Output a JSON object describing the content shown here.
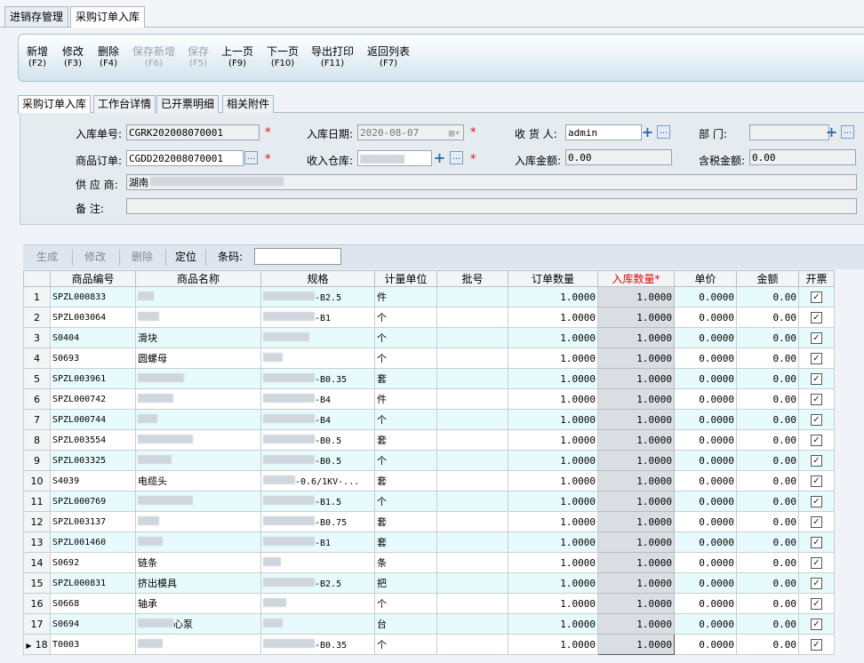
{
  "top_tabs": [
    "进销存管理",
    "采购订单入库"
  ],
  "toolbar": [
    {
      "label": "新增",
      "key": "(F2)",
      "enabled": true
    },
    {
      "label": "修改",
      "key": "(F3)",
      "enabled": true
    },
    {
      "label": "删除",
      "key": "(F4)",
      "enabled": true
    },
    {
      "label": "保存新增",
      "key": "(F6)",
      "enabled": false
    },
    {
      "label": "保存",
      "key": "(F5)",
      "enabled": false
    },
    {
      "label": "上一页",
      "key": "(F9)",
      "enabled": true
    },
    {
      "label": "下一页",
      "key": "(F10)",
      "enabled": true
    },
    {
      "label": "导出打印",
      "key": "(F11)",
      "enabled": true
    },
    {
      "label": "返回列表",
      "key": "(F7)",
      "enabled": true
    }
  ],
  "sub_tabs": [
    "采购订单入库",
    "工作台详情",
    "已开票明细",
    "相关附件"
  ],
  "form": {
    "receipt_no_label": "入库单号:",
    "receipt_no": "CGRK202008070001",
    "order_label": "商品订单:",
    "order_no": "CGDD202008070001",
    "date_label": "入库日期:",
    "date": "2020-08-07",
    "warehouse_label": "收入仓库:",
    "receiver_label": "收 货 人:",
    "receiver": "admin",
    "amount_label": "入库金额:",
    "amount": "0.00",
    "dept_label": "部    门:",
    "tax_amount_label": "含税金额:",
    "tax_amount": "0.00",
    "supplier_label": "供 应 商:",
    "supplier": "湖南",
    "note_label": "备    注:"
  },
  "grid_toolbar": {
    "generate": "生成",
    "edit": "修改",
    "delete": "删除",
    "locate": "定位",
    "barcode_label": "条码:"
  },
  "columns": [
    "",
    "商品编号",
    "商品名称",
    "规格",
    "计量单位",
    "批号",
    "订单数量",
    "入库数量*",
    "单价",
    "金额",
    "开票"
  ],
  "rows": [
    {
      "no": "1",
      "code": "SPZL000833",
      "name": "",
      "spec": "-B2.5",
      "unit": "件",
      "qty": "1.0000",
      "in_qty": "1.0000",
      "price": "0.0000",
      "amount": "0.00"
    },
    {
      "no": "2",
      "code": "SPZL003064",
      "name": "",
      "spec": "-B1",
      "unit": "个",
      "qty": "1.0000",
      "in_qty": "1.0000",
      "price": "0.0000",
      "amount": "0.00"
    },
    {
      "no": "3",
      "code": "S0404",
      "name": "滑块",
      "spec": "",
      "unit": "个",
      "qty": "1.0000",
      "in_qty": "1.0000",
      "price": "0.0000",
      "amount": "0.00"
    },
    {
      "no": "4",
      "code": "S0693",
      "name": "圆螺母",
      "spec": "",
      "unit": "个",
      "qty": "1.0000",
      "in_qty": "1.0000",
      "price": "0.0000",
      "amount": "0.00"
    },
    {
      "no": "5",
      "code": "SPZL003961",
      "name": "",
      "spec": "-B0.35",
      "unit": "套",
      "qty": "1.0000",
      "in_qty": "1.0000",
      "price": "0.0000",
      "amount": "0.00"
    },
    {
      "no": "6",
      "code": "SPZL000742",
      "name": "",
      "spec": "-B4",
      "unit": "件",
      "qty": "1.0000",
      "in_qty": "1.0000",
      "price": "0.0000",
      "amount": "0.00"
    },
    {
      "no": "7",
      "code": "SPZL000744",
      "name": "",
      "spec": "-B4",
      "unit": "个",
      "qty": "1.0000",
      "in_qty": "1.0000",
      "price": "0.0000",
      "amount": "0.00"
    },
    {
      "no": "8",
      "code": "SPZL003554",
      "name": "",
      "spec": "-B0.5",
      "unit": "套",
      "qty": "1.0000",
      "in_qty": "1.0000",
      "price": "0.0000",
      "amount": "0.00"
    },
    {
      "no": "9",
      "code": "SPZL003325",
      "name": "",
      "spec": "-B0.5",
      "unit": "个",
      "qty": "1.0000",
      "in_qty": "1.0000",
      "price": "0.0000",
      "amount": "0.00"
    },
    {
      "no": "10",
      "code": "S4039",
      "name": "电缆头",
      "spec": "-0.6/1KV-...",
      "unit": "套",
      "qty": "1.0000",
      "in_qty": "1.0000",
      "price": "0.0000",
      "amount": "0.00"
    },
    {
      "no": "11",
      "code": "SPZL000769",
      "name": "",
      "spec": "-B1.5",
      "unit": "个",
      "qty": "1.0000",
      "in_qty": "1.0000",
      "price": "0.0000",
      "amount": "0.00"
    },
    {
      "no": "12",
      "code": "SPZL003137",
      "name": "",
      "spec": "-B0.75",
      "unit": "套",
      "qty": "1.0000",
      "in_qty": "1.0000",
      "price": "0.0000",
      "amount": "0.00"
    },
    {
      "no": "13",
      "code": "SPZL001460",
      "name": "",
      "spec": "-B1",
      "unit": "套",
      "qty": "1.0000",
      "in_qty": "1.0000",
      "price": "0.0000",
      "amount": "0.00"
    },
    {
      "no": "14",
      "code": "S0692",
      "name": "链条",
      "spec": "",
      "unit": "条",
      "qty": "1.0000",
      "in_qty": "1.0000",
      "price": "0.0000",
      "amount": "0.00"
    },
    {
      "no": "15",
      "code": "SPZL000831",
      "name": "挤出模具",
      "spec": "-B2.5",
      "unit": "把",
      "qty": "1.0000",
      "in_qty": "1.0000",
      "price": "0.0000",
      "amount": "0.00"
    },
    {
      "no": "16",
      "code": "S0668",
      "name": "轴承",
      "spec": "",
      "unit": "个",
      "qty": "1.0000",
      "in_qty": "1.0000",
      "price": "0.0000",
      "amount": "0.00"
    },
    {
      "no": "17",
      "code": "S0694",
      "name": "心泵",
      "spec": "",
      "unit": "台",
      "qty": "1.0000",
      "in_qty": "1.0000",
      "price": "0.0000",
      "amount": "0.00"
    },
    {
      "no": "18",
      "code": "T0003",
      "name": "",
      "spec": "-B0.35",
      "unit": "个",
      "qty": "1.0000",
      "in_qty": "1.0000",
      "price": "0.0000",
      "amount": "0.00"
    }
  ]
}
